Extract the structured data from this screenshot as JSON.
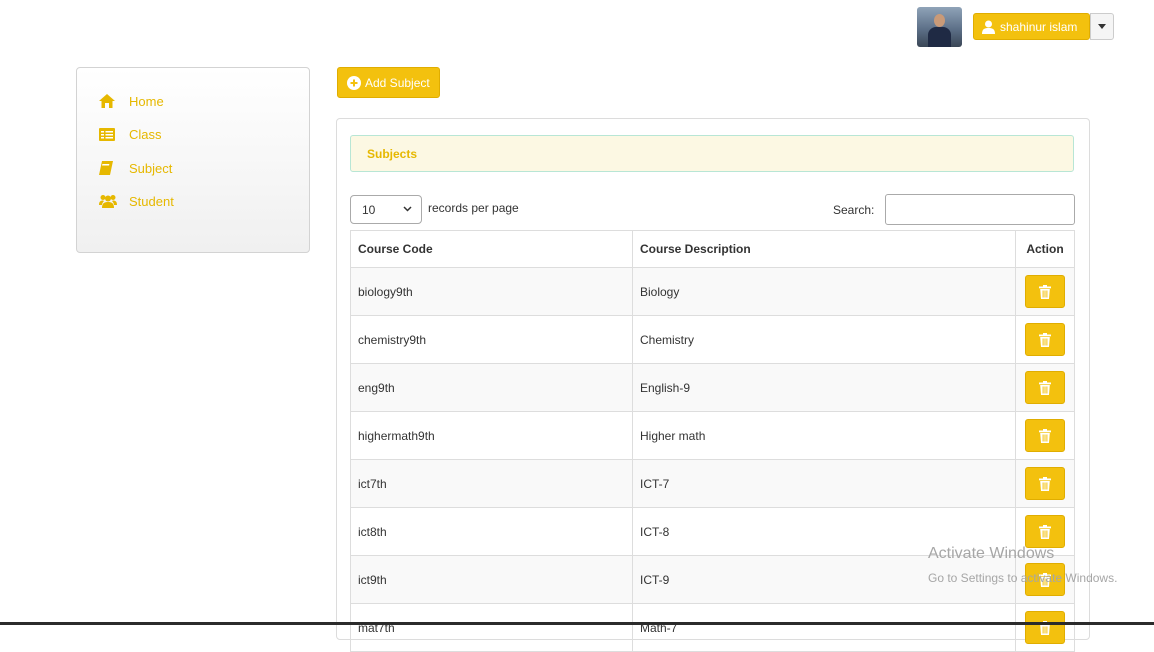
{
  "header": {
    "user_name": "shahinur islam"
  },
  "sidebar": {
    "items": [
      {
        "label": "Home",
        "icon": "home-icon"
      },
      {
        "label": "Class",
        "icon": "table-icon"
      },
      {
        "label": "Subject",
        "icon": "book-icon"
      },
      {
        "label": "Student",
        "icon": "users-icon"
      }
    ]
  },
  "toolbar": {
    "add_label": "Add Subject"
  },
  "panel": {
    "title": "Subjects",
    "length_value": "10",
    "length_suffix": "records per page",
    "search_label": "Search:",
    "search_value": ""
  },
  "table": {
    "headers": [
      "Course Code",
      "Course Description",
      "Action"
    ],
    "rows": [
      {
        "code": "biology9th",
        "description": "Biology"
      },
      {
        "code": "chemistry9th",
        "description": "Chemistry"
      },
      {
        "code": "eng9th",
        "description": "English-9"
      },
      {
        "code": "highermath9th",
        "description": "Higher math"
      },
      {
        "code": "ict7th",
        "description": "ICT-7"
      },
      {
        "code": "ict8th",
        "description": "ICT-8"
      },
      {
        "code": "ict9th",
        "description": "ICT-9"
      },
      {
        "code": "mat7th",
        "description": "Math-7"
      }
    ]
  },
  "watermark": {
    "title": "Activate Windows",
    "subtitle": "Go to Settings to activate Windows."
  },
  "colors": {
    "accent": "#f3c10e",
    "heading_bg": "#fcf8e3",
    "text": "#333333"
  }
}
